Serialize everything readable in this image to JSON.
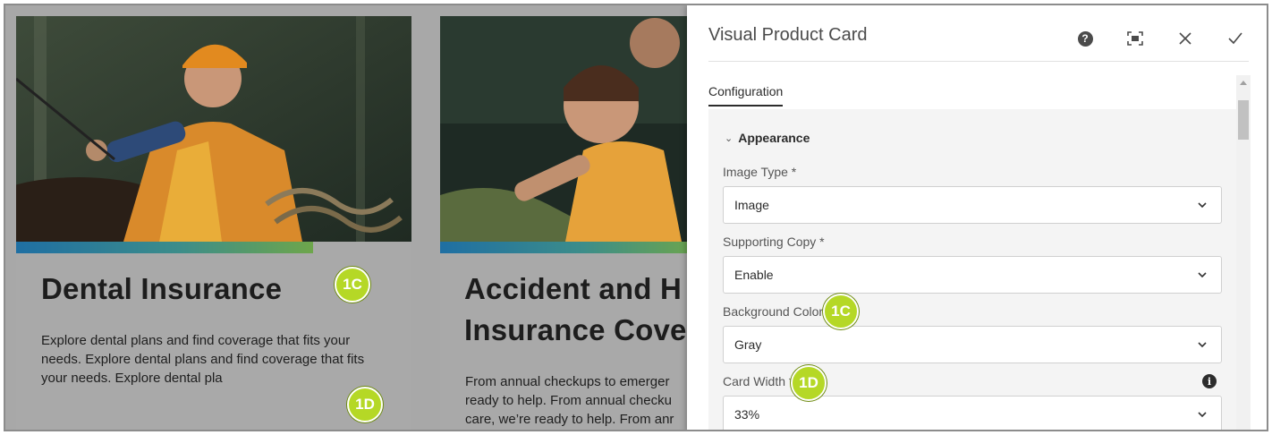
{
  "cards": [
    {
      "title": "Dental Insurance",
      "text": "Explore dental plans and find coverage that fits your needs. Explore dental plans and find coverage that fits your needs. Explore dental pla"
    },
    {
      "title_line1": "Accident and H",
      "title_line2": "Insurance Cove",
      "text_line1": "From annual checkups to emerger",
      "text_line2": "ready to help. From annual checku",
      "text_line3": "care, we’re ready to help. From anr"
    }
  ],
  "callouts": {
    "c1": "1C",
    "d1": "1D"
  },
  "dialog": {
    "title": "Visual Product Card",
    "tab": "Configuration",
    "section": "Appearance",
    "fields": [
      {
        "label": "Image Type *",
        "value": "Image"
      },
      {
        "label": "Supporting Copy *",
        "value": "Enable"
      },
      {
        "label": "Background Color *",
        "value": "Gray"
      },
      {
        "label": "Card Width *",
        "value": "33%"
      }
    ],
    "icons": [
      "help-icon",
      "fullscreen-icon",
      "close-icon",
      "checkmark-icon",
      "info-icon",
      "chevron-down-icon"
    ]
  },
  "colors": {
    "callout": "#b5d826",
    "page_bg": "#a8a8a8",
    "accent_bar_start": "#1f6fa3",
    "accent_bar_end": "#6ea64b"
  }
}
